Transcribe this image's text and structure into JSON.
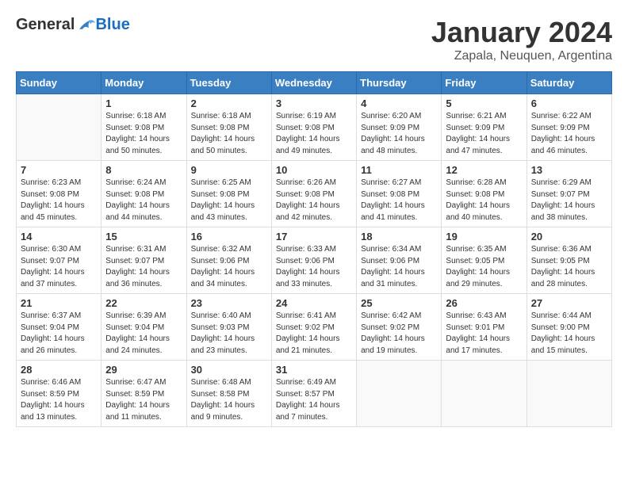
{
  "header": {
    "logo_general": "General",
    "logo_blue": "Blue",
    "month": "January 2024",
    "location": "Zapala, Neuquen, Argentina"
  },
  "days_of_week": [
    "Sunday",
    "Monday",
    "Tuesday",
    "Wednesday",
    "Thursday",
    "Friday",
    "Saturday"
  ],
  "weeks": [
    [
      {
        "day": "",
        "empty": true
      },
      {
        "day": "1",
        "sunrise": "6:18 AM",
        "sunset": "9:08 PM",
        "daylight": "14 hours and 50 minutes."
      },
      {
        "day": "2",
        "sunrise": "6:18 AM",
        "sunset": "9:08 PM",
        "daylight": "14 hours and 50 minutes."
      },
      {
        "day": "3",
        "sunrise": "6:19 AM",
        "sunset": "9:08 PM",
        "daylight": "14 hours and 49 minutes."
      },
      {
        "day": "4",
        "sunrise": "6:20 AM",
        "sunset": "9:09 PM",
        "daylight": "14 hours and 48 minutes."
      },
      {
        "day": "5",
        "sunrise": "6:21 AM",
        "sunset": "9:09 PM",
        "daylight": "14 hours and 47 minutes."
      },
      {
        "day": "6",
        "sunrise": "6:22 AM",
        "sunset": "9:09 PM",
        "daylight": "14 hours and 46 minutes."
      }
    ],
    [
      {
        "day": "7",
        "sunrise": "6:23 AM",
        "sunset": "9:08 PM",
        "daylight": "14 hours and 45 minutes."
      },
      {
        "day": "8",
        "sunrise": "6:24 AM",
        "sunset": "9:08 PM",
        "daylight": "14 hours and 44 minutes."
      },
      {
        "day": "9",
        "sunrise": "6:25 AM",
        "sunset": "9:08 PM",
        "daylight": "14 hours and 43 minutes."
      },
      {
        "day": "10",
        "sunrise": "6:26 AM",
        "sunset": "9:08 PM",
        "daylight": "14 hours and 42 minutes."
      },
      {
        "day": "11",
        "sunrise": "6:27 AM",
        "sunset": "9:08 PM",
        "daylight": "14 hours and 41 minutes."
      },
      {
        "day": "12",
        "sunrise": "6:28 AM",
        "sunset": "9:08 PM",
        "daylight": "14 hours and 40 minutes."
      },
      {
        "day": "13",
        "sunrise": "6:29 AM",
        "sunset": "9:07 PM",
        "daylight": "14 hours and 38 minutes."
      }
    ],
    [
      {
        "day": "14",
        "sunrise": "6:30 AM",
        "sunset": "9:07 PM",
        "daylight": "14 hours and 37 minutes."
      },
      {
        "day": "15",
        "sunrise": "6:31 AM",
        "sunset": "9:07 PM",
        "daylight": "14 hours and 36 minutes."
      },
      {
        "day": "16",
        "sunrise": "6:32 AM",
        "sunset": "9:06 PM",
        "daylight": "14 hours and 34 minutes."
      },
      {
        "day": "17",
        "sunrise": "6:33 AM",
        "sunset": "9:06 PM",
        "daylight": "14 hours and 33 minutes."
      },
      {
        "day": "18",
        "sunrise": "6:34 AM",
        "sunset": "9:06 PM",
        "daylight": "14 hours and 31 minutes."
      },
      {
        "day": "19",
        "sunrise": "6:35 AM",
        "sunset": "9:05 PM",
        "daylight": "14 hours and 29 minutes."
      },
      {
        "day": "20",
        "sunrise": "6:36 AM",
        "sunset": "9:05 PM",
        "daylight": "14 hours and 28 minutes."
      }
    ],
    [
      {
        "day": "21",
        "sunrise": "6:37 AM",
        "sunset": "9:04 PM",
        "daylight": "14 hours and 26 minutes."
      },
      {
        "day": "22",
        "sunrise": "6:39 AM",
        "sunset": "9:04 PM",
        "daylight": "14 hours and 24 minutes."
      },
      {
        "day": "23",
        "sunrise": "6:40 AM",
        "sunset": "9:03 PM",
        "daylight": "14 hours and 23 minutes."
      },
      {
        "day": "24",
        "sunrise": "6:41 AM",
        "sunset": "9:02 PM",
        "daylight": "14 hours and 21 minutes."
      },
      {
        "day": "25",
        "sunrise": "6:42 AM",
        "sunset": "9:02 PM",
        "daylight": "14 hours and 19 minutes."
      },
      {
        "day": "26",
        "sunrise": "6:43 AM",
        "sunset": "9:01 PM",
        "daylight": "14 hours and 17 minutes."
      },
      {
        "day": "27",
        "sunrise": "6:44 AM",
        "sunset": "9:00 PM",
        "daylight": "14 hours and 15 minutes."
      }
    ],
    [
      {
        "day": "28",
        "sunrise": "6:46 AM",
        "sunset": "8:59 PM",
        "daylight": "14 hours and 13 minutes."
      },
      {
        "day": "29",
        "sunrise": "6:47 AM",
        "sunset": "8:59 PM",
        "daylight": "14 hours and 11 minutes."
      },
      {
        "day": "30",
        "sunrise": "6:48 AM",
        "sunset": "8:58 PM",
        "daylight": "14 hours and 9 minutes."
      },
      {
        "day": "31",
        "sunrise": "6:49 AM",
        "sunset": "8:57 PM",
        "daylight": "14 hours and 7 minutes."
      },
      {
        "day": "",
        "empty": true
      },
      {
        "day": "",
        "empty": true
      },
      {
        "day": "",
        "empty": true
      }
    ]
  ]
}
